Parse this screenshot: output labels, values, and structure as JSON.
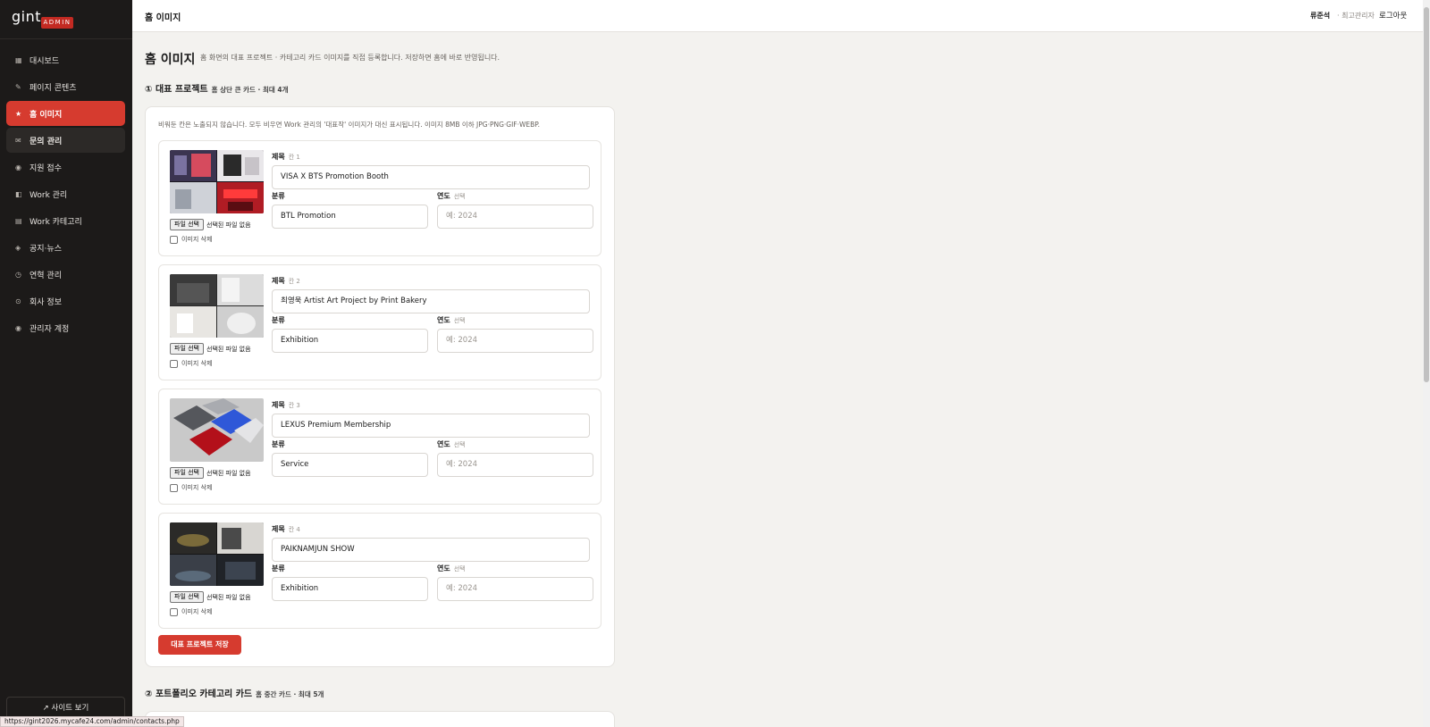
{
  "sidebar": {
    "logo": "gint",
    "badge": "ADMIN",
    "items": [
      {
        "icon": "▦",
        "label": "대시보드"
      },
      {
        "icon": "✎",
        "label": "페이지 콘텐츠"
      },
      {
        "icon": "★",
        "label": "홈 이미지"
      },
      {
        "icon": "✉",
        "label": "문의 관리"
      },
      {
        "icon": "◉",
        "label": "지원 접수"
      },
      {
        "icon": "◧",
        "label": "Work 관리"
      },
      {
        "icon": "▤",
        "label": "Work 카테고리"
      },
      {
        "icon": "◈",
        "label": "공지·뉴스"
      },
      {
        "icon": "◷",
        "label": "연혁 관리"
      },
      {
        "icon": "⊙",
        "label": "회사 정보"
      },
      {
        "icon": "◉",
        "label": "관리자 계정"
      }
    ],
    "site_link": "↗ 사이트 보기"
  },
  "status_url": "https://gint2026.mycafe24.com/admin/contacts.php",
  "topbar": {
    "title": "홈 이미지",
    "user": "류준석",
    "role": "· 최고관리자",
    "logout": "로그아웃"
  },
  "page": {
    "title": "홈 이미지",
    "desc": "홈 화면의 대표 프로젝트 · 카테고리 카드 이미지를 직접 등록합니다. 저장하면 홈에 바로 반영됩니다."
  },
  "section1": {
    "title": "① 대표 프로젝트",
    "sub": "홈 상단 큰 카드 · 최대 4개",
    "note": "비워둔 칸은 노출되지 않습니다. 모두 비우면 Work 관리의 '대표작' 이미지가 대신 표시됩니다. 이미지 8MB 이하 JPG·PNG·GIF·WEBP.",
    "save": "대표 프로젝트 저장"
  },
  "labels": {
    "title": "제목",
    "category": "분류",
    "year": "연도",
    "year_sub": "선택",
    "file_btn": "파일 선택",
    "file_none": "선택된 파일 없음",
    "delete": "이미지 삭제",
    "year_ph": "예: 2024"
  },
  "cards": [
    {
      "slot": "칸 1",
      "title": "VISA X BTS Promotion Booth",
      "category": "BTL Promotion"
    },
    {
      "slot": "칸 2",
      "title": "최영욱 Artist Art Project by Print Bakery",
      "category": "Exhibition"
    },
    {
      "slot": "칸 3",
      "title": "LEXUS Premium Membership",
      "category": "Service"
    },
    {
      "slot": "칸 4",
      "title": "PAIKNAMJUN SHOW",
      "category": "Exhibition"
    }
  ],
  "section2": {
    "title": "② 포트폴리오 카테고리 카드",
    "sub": "홈 중간 카드 · 최대 5개"
  },
  "colors": {
    "accent": "#d63b2f",
    "sidebar": "#1c1a19"
  }
}
